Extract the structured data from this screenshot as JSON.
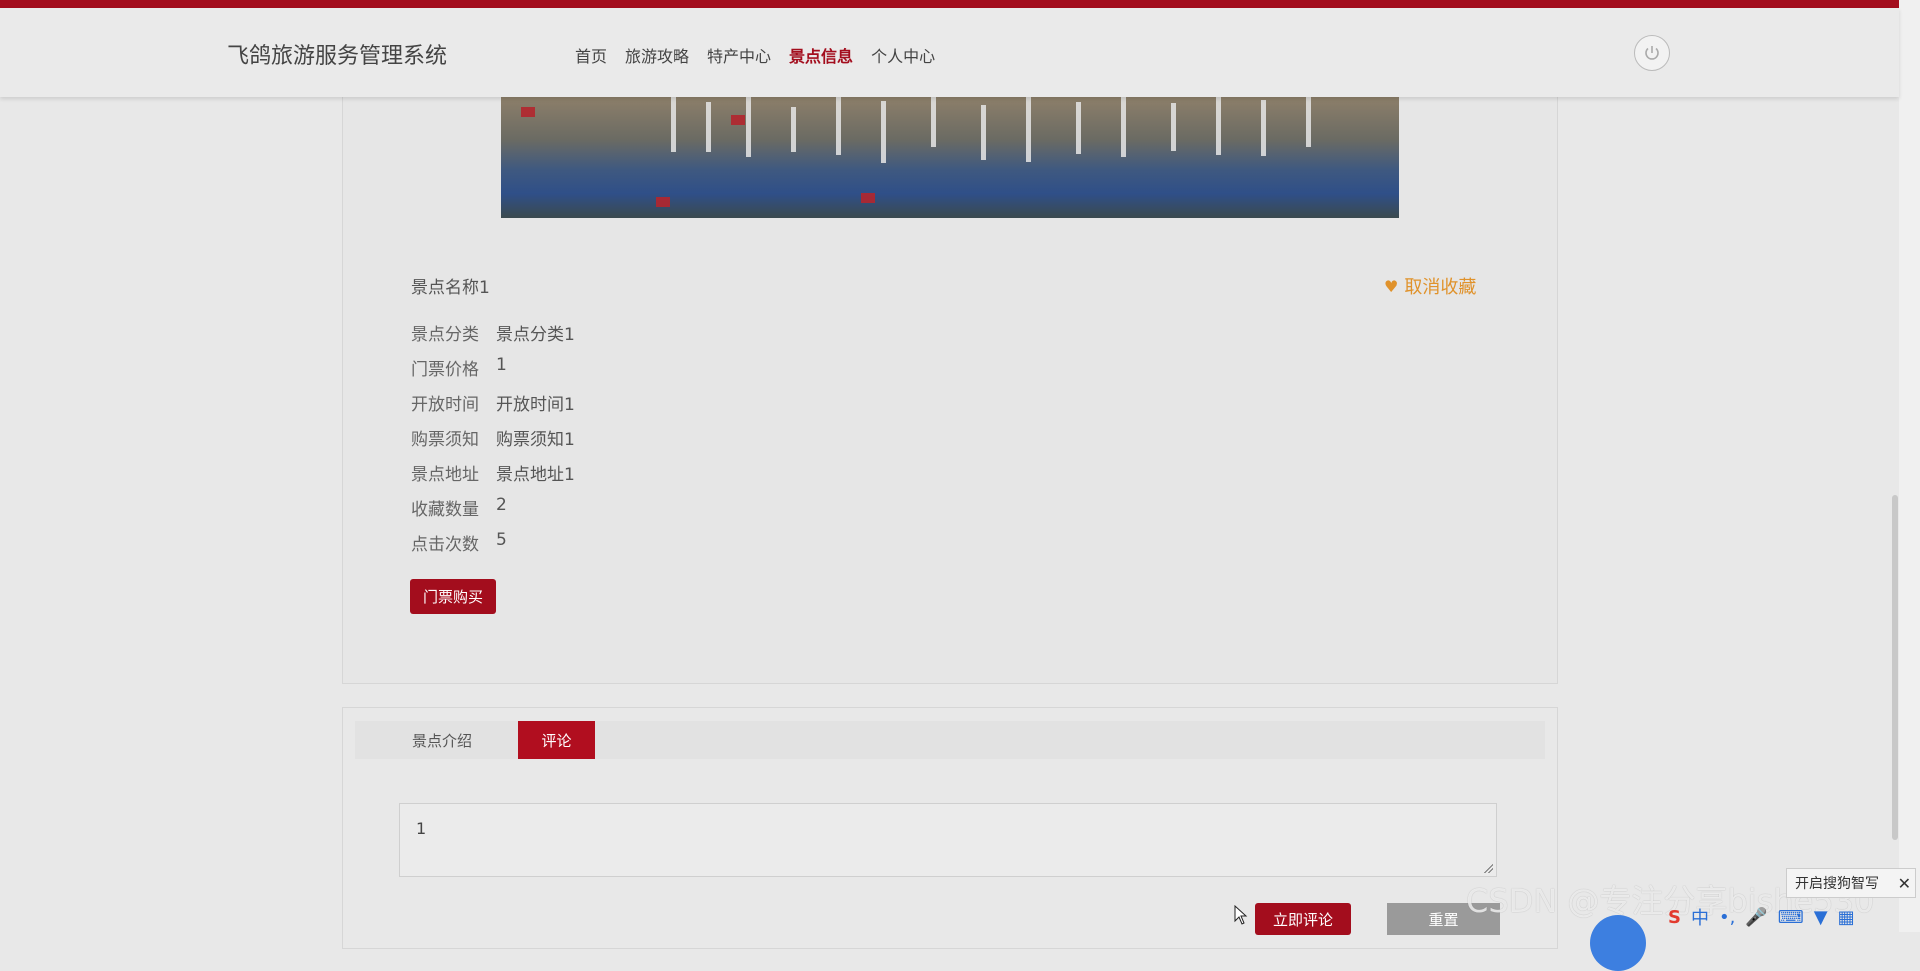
{
  "header": {
    "brand": "飞鸽旅游服务管理系统",
    "nav": [
      "首页",
      "旅游攻略",
      "特产中心",
      "景点信息",
      "个人中心"
    ],
    "active_nav": "景点信息"
  },
  "detail": {
    "name": "景点名称1",
    "favorite_label": "取消收藏",
    "fields": [
      {
        "k": "景点分类",
        "v": "景点分类1"
      },
      {
        "k": "门票价格",
        "v": "1"
      },
      {
        "k": "开放时间",
        "v": "开放时间1"
      },
      {
        "k": "购票须知",
        "v": "购票须知1"
      },
      {
        "k": "景点地址",
        "v": "景点地址1"
      },
      {
        "k": "收藏数量",
        "v": "2"
      },
      {
        "k": "点击次数",
        "v": "5"
      }
    ],
    "buy_label": "门票购买"
  },
  "tabs": {
    "intro": "景点介绍",
    "comment": "评论"
  },
  "comment_form": {
    "value": "1",
    "submit_label": "立即评论",
    "reset_label": "重置"
  },
  "overlay": {
    "watermark": "CSDN @专注分享bishe530",
    "ime_tip": "开启搜狗智写",
    "ime_status": "中"
  },
  "colors": {
    "accent": "#a30d1d",
    "favorite": "#e0922b"
  }
}
